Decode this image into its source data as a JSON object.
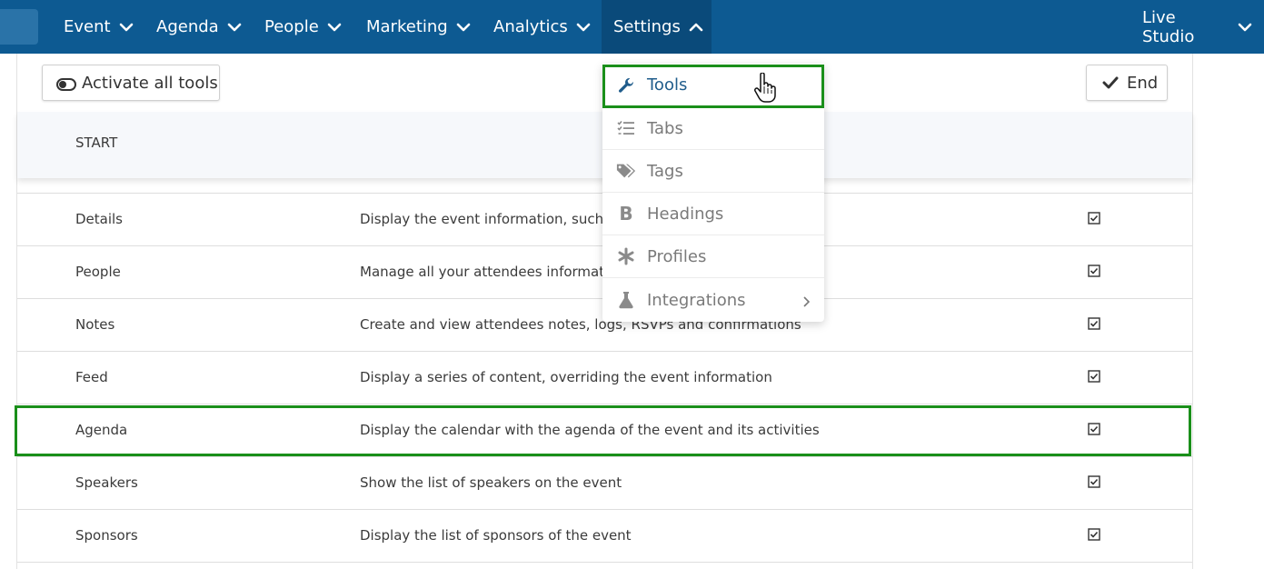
{
  "nav": {
    "items": [
      {
        "label": "Event"
      },
      {
        "label": "Agenda"
      },
      {
        "label": "People"
      },
      {
        "label": "Marketing"
      },
      {
        "label": "Analytics"
      },
      {
        "label": "Settings"
      }
    ],
    "right": {
      "label": "Live Studio"
    }
  },
  "toolbar": {
    "activate_label": "Activate all tools",
    "end_label": "End"
  },
  "table": {
    "section_label": "START",
    "rows": [
      {
        "name": "Details",
        "description": "Display the event information, such as",
        "checked": true
      },
      {
        "name": "People",
        "description": "Manage all your attendees information",
        "checked": true
      },
      {
        "name": "Notes",
        "description": "Create and view attendees notes, logs, RSVPs and confirmations",
        "checked": true
      },
      {
        "name": "Feed",
        "description": "Display a series of content, overriding the event information",
        "checked": true
      },
      {
        "name": "Agenda",
        "description": "Display the calendar with the agenda of the event and its activities",
        "checked": true
      },
      {
        "name": "Speakers",
        "description": "Show the list of speakers on the event",
        "checked": true
      },
      {
        "name": "Sponsors",
        "description": "Display the list of sponsors of the event",
        "checked": true
      }
    ]
  },
  "settings_menu": {
    "items": [
      {
        "label": "Tools",
        "icon": "wrench-icon"
      },
      {
        "label": "Tabs",
        "icon": "list-check-icon"
      },
      {
        "label": "Tags",
        "icon": "tags-icon"
      },
      {
        "label": "Headings",
        "icon": "bold-icon"
      },
      {
        "label": "Profiles",
        "icon": "asterisk-icon"
      },
      {
        "label": "Integrations",
        "icon": "flask-icon"
      }
    ]
  },
  "colors": {
    "navbar": "#0d5a92",
    "highlight": "#1a8f1a",
    "menu_active_text": "#1f5c8b"
  }
}
